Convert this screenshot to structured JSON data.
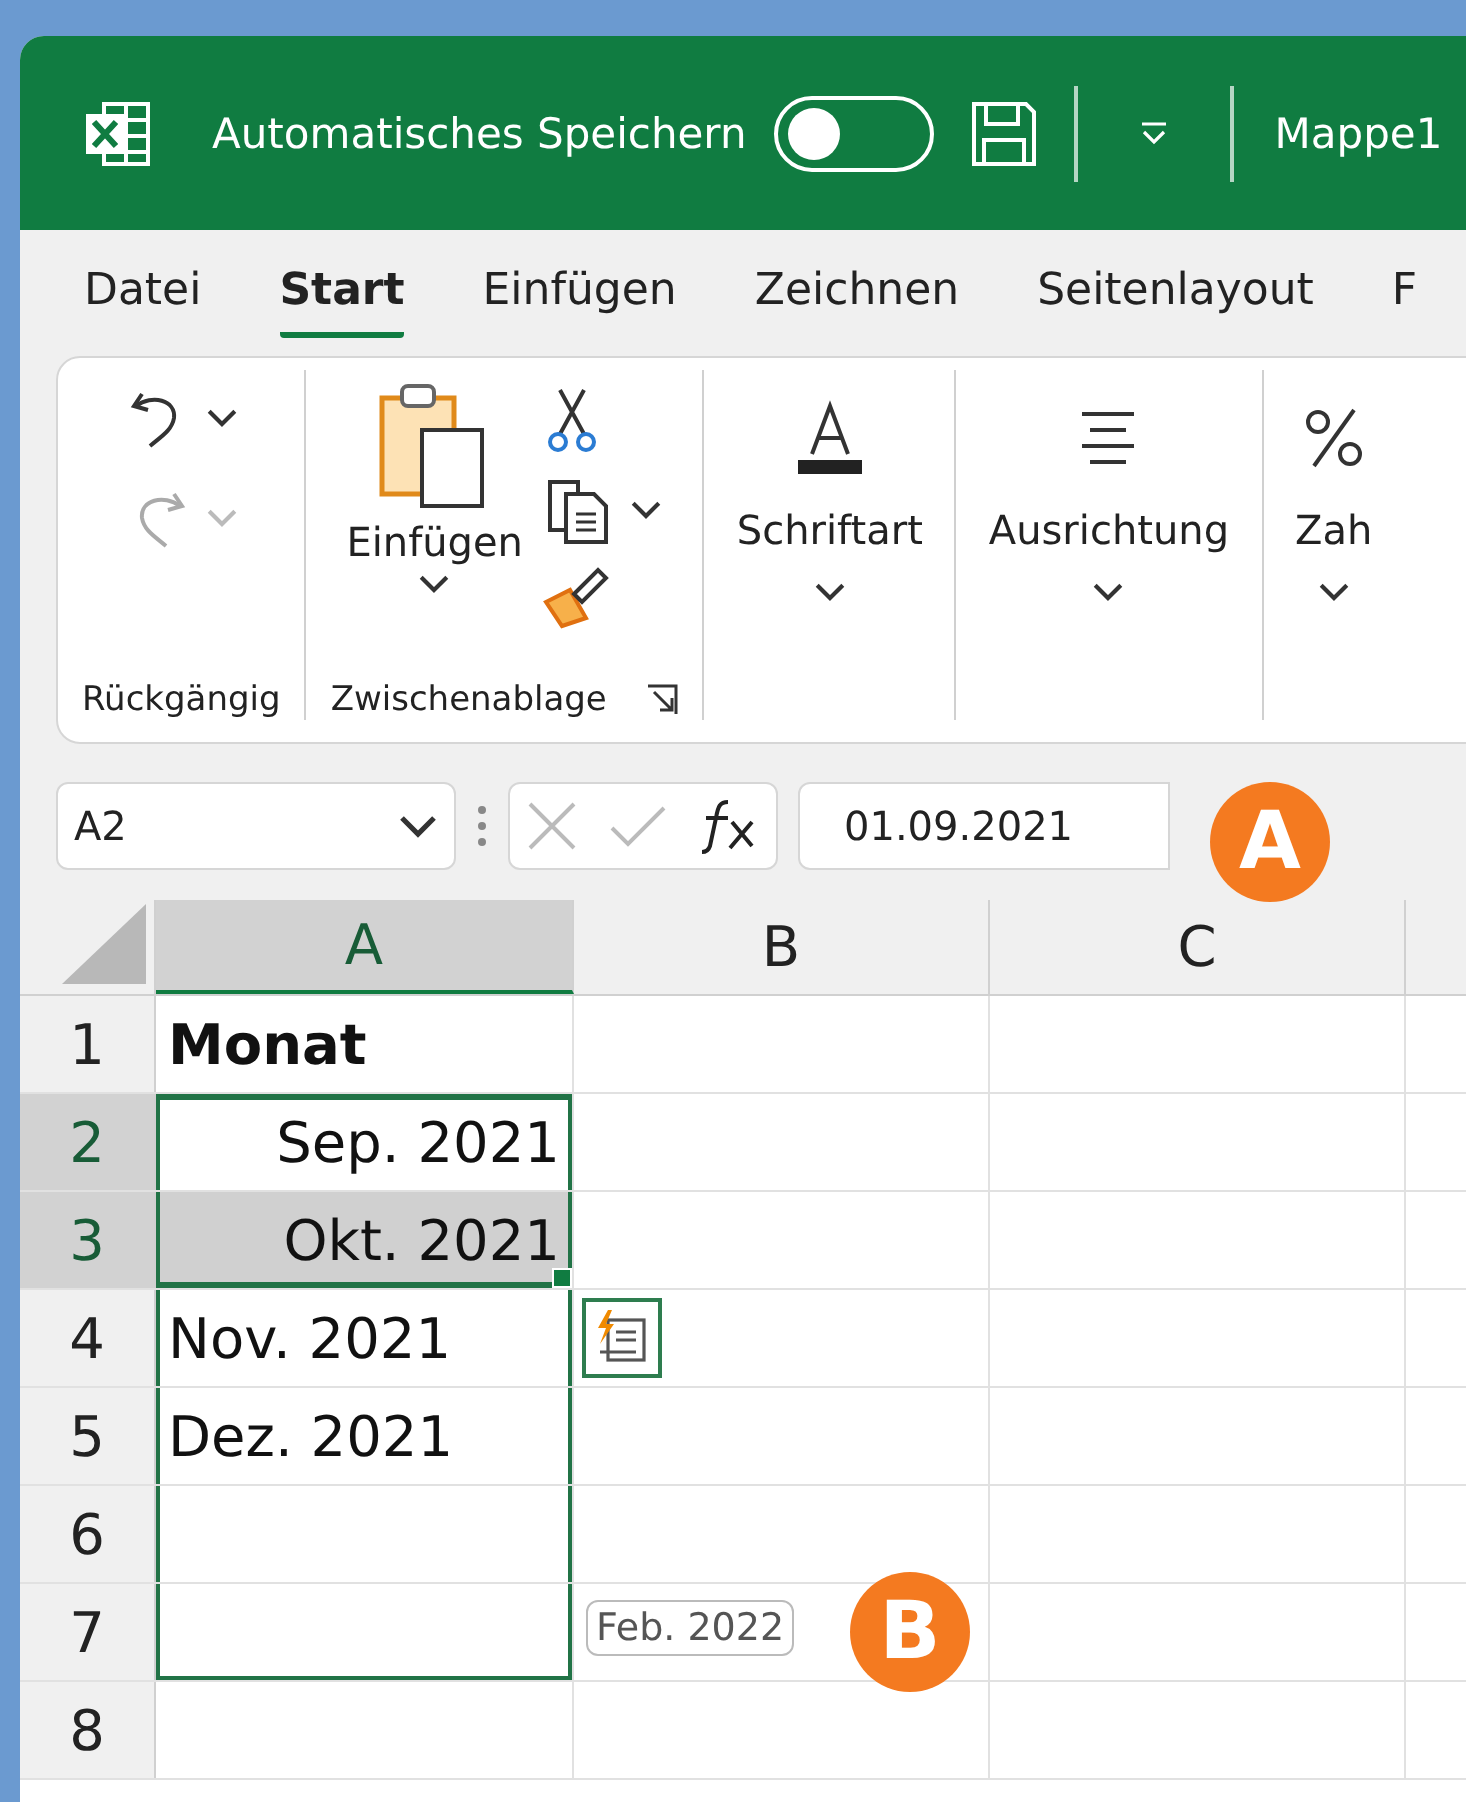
{
  "titlebar": {
    "autosave_label": "Automatisches Speichern",
    "autosave_on": false,
    "title": "Mappe1"
  },
  "tabs": [
    {
      "label": "Datei",
      "selected": false
    },
    {
      "label": "Start",
      "selected": true
    },
    {
      "label": "Einfügen",
      "selected": false
    },
    {
      "label": "Zeichnen",
      "selected": false
    },
    {
      "label": "Seitenlayout",
      "selected": false
    },
    {
      "label": "F",
      "selected": false
    }
  ],
  "ribbon": [
    {
      "kind": "undo",
      "label": "Rückgängig",
      "redo_disabled": true
    },
    {
      "kind": "clipboard",
      "label": "Zwischenablage",
      "button": "Einfügen"
    },
    {
      "kind": "font",
      "button": "Schriftart"
    },
    {
      "kind": "align",
      "button": "Ausrichtung"
    },
    {
      "kind": "number",
      "button": "Zah"
    }
  ],
  "name_box": "A2",
  "formula": "01.09.2021",
  "columns": [
    {
      "label": "A",
      "selected": true
    },
    {
      "label": "B",
      "selected": false
    },
    {
      "label": "C",
      "selected": false
    }
  ],
  "rows": [
    {
      "number": "1",
      "selected": false,
      "cells": [
        {
          "text": "Monat",
          "kind": "header",
          "selected": false,
          "in_fill_range": false
        }
      ]
    },
    {
      "number": "2",
      "selected": true,
      "cells": [
        {
          "text": "Sep. 2021",
          "kind": "date",
          "selected": true,
          "in_fill_range": true
        }
      ]
    },
    {
      "number": "3",
      "selected": true,
      "cells": [
        {
          "text": "Okt. 2021",
          "kind": "date",
          "selected": true,
          "in_fill_range": true
        }
      ]
    },
    {
      "number": "4",
      "selected": false,
      "cells": [
        {
          "text": "Nov. 2021",
          "kind": "text",
          "selected": false,
          "in_fill_range": true
        }
      ]
    },
    {
      "number": "5",
      "selected": false,
      "cells": [
        {
          "text": "Dez. 2021",
          "kind": "text",
          "selected": false,
          "in_fill_range": true
        }
      ]
    },
    {
      "number": "6",
      "selected": false,
      "cells": [
        {
          "kind": "empty",
          "selected": false,
          "in_fill_range": true
        }
      ]
    },
    {
      "number": "7",
      "selected": false,
      "cells": [
        {
          "kind": "empty",
          "selected": false,
          "in_fill_range": true
        }
      ]
    },
    {
      "number": "8",
      "selected": false,
      "cells": [
        {
          "kind": "empty",
          "selected": false,
          "in_fill_range": false
        }
      ]
    }
  ],
  "fill_preview": "Feb. 2022",
  "callouts": [
    {
      "label": "A"
    },
    {
      "label": "B"
    }
  ]
}
